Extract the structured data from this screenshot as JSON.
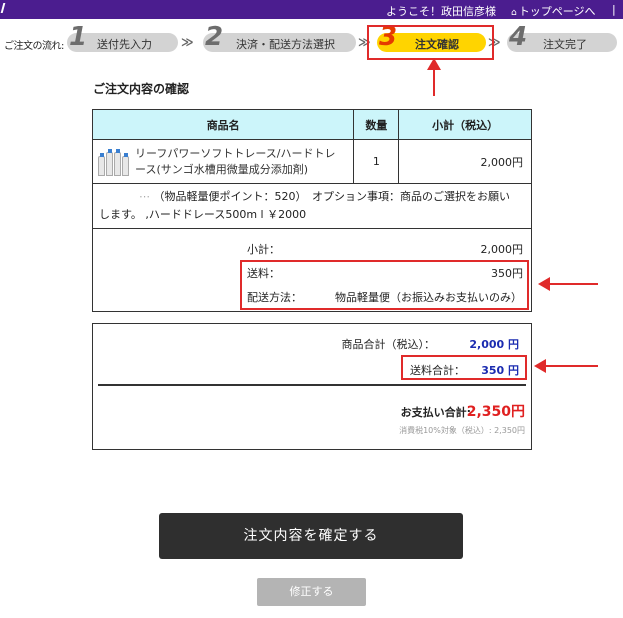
{
  "header": {
    "welcome": "ようこそ！政田信彦様",
    "home_link": "トップページへ",
    "separator": "|",
    "brand_color": "#4b1d8f"
  },
  "flow": {
    "label": "ご注文の流れ:",
    "arrow": "≫",
    "steps": [
      {
        "num": "1",
        "label": "送付先入力",
        "active": false
      },
      {
        "num": "2",
        "label": "決済・配送方法選択",
        "active": false
      },
      {
        "num": "3",
        "label": "注文確認",
        "active": true
      },
      {
        "num": "4",
        "label": "注文完了",
        "active": false
      }
    ],
    "active_color": "#ffd400",
    "inactive_color": "#d3d3d3"
  },
  "section_title": "ご注文内容の確認",
  "table": {
    "headers": {
      "product": "商品名",
      "qty": "数量",
      "subtotal": "小計（税込）"
    },
    "rows": [
      {
        "name_line1": "リーフパワーソフトトレース/ハードトレ",
        "name_line2": "ース(サンゴ水槽用微量成分添加剤)",
        "qty": "1",
        "subtotal": "2,000円",
        "option_line1": "（物品軽量便ポイント：520）　オプション事項：商品のご選択をお願い",
        "option_line2": "します。 ,ハードドレース500m l ￥2000",
        "option_prefix": "⋯"
      }
    ]
  },
  "summary": {
    "subtotal_label": "小計：",
    "subtotal_value": "2,000円",
    "shipping_label": "送料：",
    "shipping_value": "350円",
    "method_label": "配送方法：",
    "method_value": "物品軽量便（お振込みお支払いのみ）"
  },
  "totals": {
    "items_label": "商品合計（税込）：",
    "items_value": "2,000 円",
    "shipping_label": "送料合計：",
    "shipping_value": "350 円",
    "payment_label": "お支払い合計:",
    "payment_value": "2,350円",
    "tax_note": "消費税10%対象（税込）: 2,350円"
  },
  "buttons": {
    "confirm": "注文内容を確定する",
    "fix": "修正する"
  },
  "highlight_color": "#e02a2a"
}
